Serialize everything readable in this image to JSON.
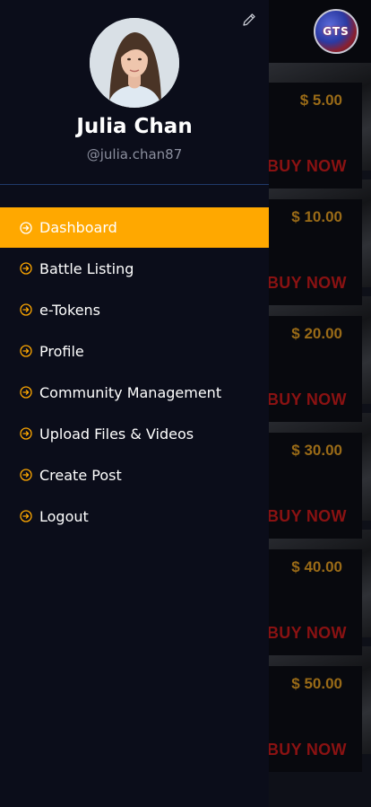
{
  "profile": {
    "name": "Julia Chan",
    "handle": "@julia.chan87"
  },
  "menu": {
    "items": [
      {
        "label": "Dashboard",
        "active": true
      },
      {
        "label": "Battle Listing",
        "active": false
      },
      {
        "label": "e-Tokens",
        "active": false
      },
      {
        "label": "Profile",
        "active": false
      },
      {
        "label": "Community Management",
        "active": false
      },
      {
        "label": "Upload Files & Videos",
        "active": false
      },
      {
        "label": "Create Post",
        "active": false
      },
      {
        "label": "Logout",
        "active": false
      }
    ]
  },
  "logo": {
    "text": "GTS"
  },
  "listing": {
    "cards": [
      {
        "price": "$ 5.00",
        "cta": "BUY NOW"
      },
      {
        "price": "$ 10.00",
        "cta": "BUY NOW"
      },
      {
        "price": "$ 20.00",
        "cta": "BUY NOW"
      },
      {
        "price": "$ 30.00",
        "cta": "BUY NOW"
      },
      {
        "price": "$ 40.00",
        "cta": "BUY NOW"
      },
      {
        "price": "$ 50.00",
        "cta": "BUY NOW"
      }
    ]
  },
  "colors": {
    "accent": "#ffa800",
    "drawer_bg": "#0b0d1a",
    "price": "#9a6b17",
    "buy_now": "#8a1212"
  }
}
